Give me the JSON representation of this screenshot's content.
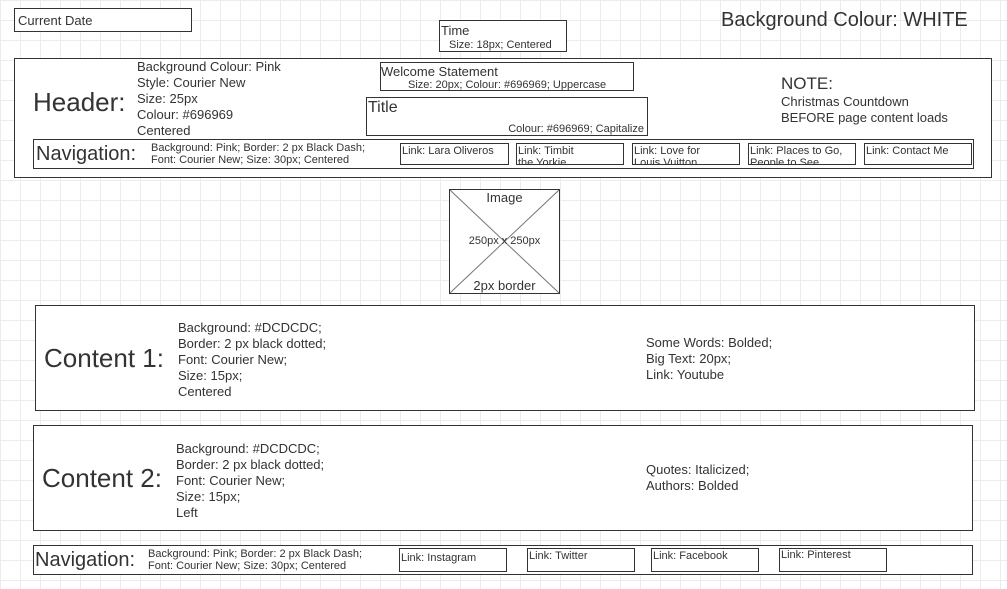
{
  "page": {
    "background_note": "Background Colour: WHITE"
  },
  "current_date": "Current Date",
  "time": {
    "label": "Time",
    "note": "Size: 18px; Centered"
  },
  "header": {
    "label": "Header:",
    "style_lines": [
      "Background Colour: Pink",
      "Style: Courier New",
      "Size: 25px",
      "Colour: #696969",
      "Centered"
    ],
    "welcome": {
      "label": "Welcome Statement",
      "note": "Size: 20px; Colour: #696969; Uppercase"
    },
    "title": {
      "label": "Title",
      "note": "Colour: #696969; Capitalize"
    },
    "note": {
      "heading": "NOTE:",
      "lines": [
        "Christmas Countdown",
        "BEFORE page content loads"
      ]
    },
    "nav": {
      "label": "Navigation:",
      "style_lines": [
        "Background: Pink; Border: 2 px Black Dash;",
        "Font: Courier New; Size: 30px; Centered"
      ],
      "links": [
        "Link: Lara Oliveros",
        "Link: Timbit the Yorkie",
        "Link: Love for Louis Vuitton",
        "Link: Places to Go, People to See",
        "Link: Contact Me"
      ]
    }
  },
  "image": {
    "label": "Image",
    "size": "250px x 250px",
    "border": "2px border"
  },
  "content1": {
    "label": "Content 1:",
    "style_lines": [
      "Background: #DCDCDC;",
      "Border: 2 px black dotted;",
      "Font: Courier New;",
      "Size: 15px;",
      "Centered"
    ],
    "notes": [
      "Some Words: Bolded;",
      "Big Text: 20px;",
      "Link: Youtube"
    ]
  },
  "content2": {
    "label": "Content 2:",
    "style_lines": [
      "Background: #DCDCDC;",
      "Border: 2 px black dotted;",
      "Font: Courier New;",
      "Size: 15px;",
      "Left"
    ],
    "notes": [
      "Quotes: Italicized;",
      "Authors: Bolded"
    ]
  },
  "footer_nav": {
    "label": "Navigation:",
    "style_lines": [
      "Background: Pink; Border: 2 px Black Dash;",
      "Font: Courier New; Size: 30px; Centered"
    ],
    "links": [
      "Link: Instagram",
      "Link: Twitter",
      "Link: Facebook",
      "Link: Pinterest"
    ]
  }
}
